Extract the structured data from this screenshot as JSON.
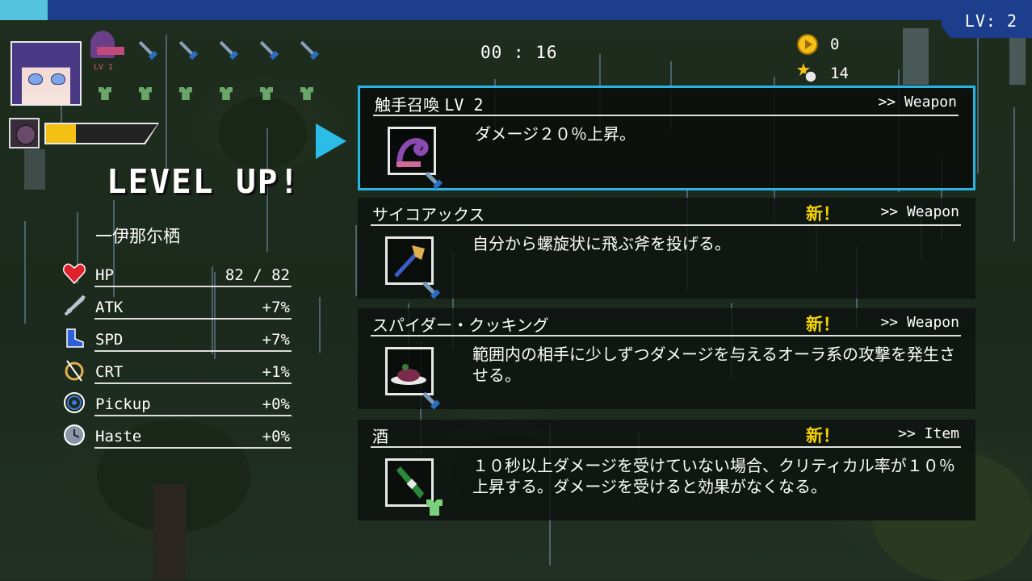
{
  "top_bar": {
    "level_label": "LV: 2",
    "xp_fraction": 0.046
  },
  "hud": {
    "timer": "00 : 16",
    "coins": "0",
    "kills": "14",
    "weapon_level_label": "LV 1",
    "hp_bar_fraction": 0.27
  },
  "level_up": {
    "heading": "LEVEL UP!",
    "character_name": "一伊那尓栖"
  },
  "stats": [
    {
      "name": "HP",
      "value": "82 / 82",
      "icon": "heart-icon"
    },
    {
      "name": "ATK",
      "value": "+7%",
      "icon": "sword-icon"
    },
    {
      "name": "SPD",
      "value": "+7%",
      "icon": "boot-icon"
    },
    {
      "name": "CRT",
      "value": "+1%",
      "icon": "crit-icon"
    },
    {
      "name": "Pickup",
      "value": "+0%",
      "icon": "magnet-icon"
    },
    {
      "name": "Haste",
      "value": "+0%",
      "icon": "clock-icon"
    }
  ],
  "options": [
    {
      "title": "触手召喚",
      "level": "LV 2",
      "new_tag": "",
      "kind": ">> Weapon",
      "description": "ダメージ２０％上昇。",
      "icon": "tentacle-icon"
    },
    {
      "title": "サイコアックス",
      "level": "",
      "new_tag": "新！",
      "kind": ">> Weapon",
      "description": "自分から螺旋状に飛ぶ斧を投げる。",
      "icon": "axe-icon"
    },
    {
      "title": "スパイダー・クッキング",
      "level": "",
      "new_tag": "新！",
      "kind": ">> Weapon",
      "description": "範囲内の相手に少しずつダメージを与えるオーラ系の攻撃を発生させる。",
      "icon": "spider-dish-icon"
    },
    {
      "title": "酒",
      "level": "",
      "new_tag": "新！",
      "kind": ">> Item",
      "description": "１０秒以上ダメージを受けていない場合、クリティカル率が１０％上昇する。ダメージを受けると効果がなくなる。",
      "icon": "sake-bottle-icon"
    }
  ],
  "colors": {
    "accent": "#27b5e6",
    "xp_bar": "#1c3e8c",
    "xp_fill": "#53c4dc",
    "hp_fill": "#f3c013",
    "new_tag": "#f5d400"
  }
}
